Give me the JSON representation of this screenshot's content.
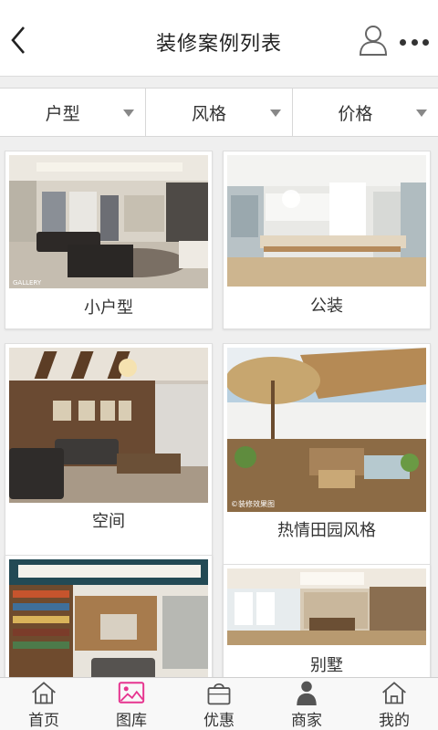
{
  "header": {
    "title": "装修案例列表"
  },
  "filters": [
    {
      "label": "户型"
    },
    {
      "label": "风格"
    },
    {
      "label": "价格"
    }
  ],
  "cases": [
    {
      "caption": "小户型",
      "watermark": "GALLERY"
    },
    {
      "caption": "公装"
    },
    {
      "caption": "空间"
    },
    {
      "caption": "热情田园风格",
      "watermark": "©装修效果图"
    },
    {
      "caption": ""
    },
    {
      "caption": "别墅"
    }
  ],
  "tabs": [
    {
      "label": "首页",
      "icon": "home-icon"
    },
    {
      "label": "图库",
      "icon": "gallery-icon",
      "active": true
    },
    {
      "label": "优惠",
      "icon": "shopping-bag-icon"
    },
    {
      "label": "商家",
      "icon": "person-icon"
    },
    {
      "label": "我的",
      "icon": "home-outline-icon"
    }
  ],
  "colors": {
    "accent": "#e6348f",
    "text": "#333333",
    "background": "#efefef"
  }
}
